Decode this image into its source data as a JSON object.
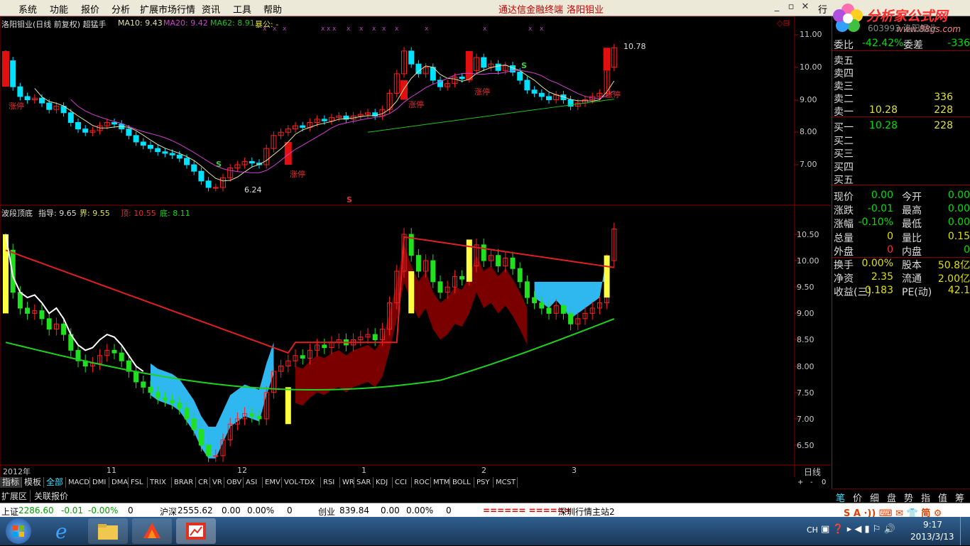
{
  "menubar": {
    "items": [
      "系统",
      "功能",
      "报价",
      "分析",
      "扩展市场行情",
      "资讯",
      "工具",
      "帮助"
    ],
    "title_left": "通达信金融终端",
    "title_right": "洛阳钼业",
    "logo_text": "分析家公式网",
    "logo_url": "www.88gs.com",
    "right_tab": "行"
  },
  "main_chart": {
    "header_title": "洛阳钼业(日线 前复权) 超猛手",
    "ma10": "MA10: 9.43",
    "ma20": "MA20: 9.42",
    "ma62": "MA62: 8.91",
    "extra": "暴公: -",
    "axis": [
      "11.00",
      "10.00",
      "9.00",
      "8.00",
      "7.00"
    ],
    "label_high": "10.78",
    "label_low": "6.24",
    "zt_labels": [
      "涨停",
      "涨停",
      "涨停",
      "涨停",
      "涨停"
    ],
    "s_labels": [
      "S",
      "S",
      "S"
    ]
  },
  "sub_chart": {
    "header_name": "波段顶底",
    "zhidao": "指导: 9.65",
    "jie": "界: 9.55",
    "ding": "顶: 10.55",
    "di": "底: 8.11",
    "axis": [
      "10.50",
      "10.00",
      "9.50",
      "9.00",
      "8.50",
      "8.00",
      "7.50",
      "7.00",
      "6.50"
    ]
  },
  "xaxis": {
    "labels": [
      "2012年",
      "11",
      "12",
      "1",
      "2",
      "3"
    ],
    "period": "日线"
  },
  "tabs": {
    "left": [
      "指标",
      "模板",
      "全部"
    ],
    "items": [
      "MACD",
      "DMI",
      "DMA",
      "FSL",
      "TRIX",
      "BRAR",
      "CR",
      "VR",
      "OBV",
      "ASI",
      "EMV",
      "VOL-TDX",
      "RSI",
      "WR",
      "SAR",
      "KDJ",
      "CCI",
      "ROC",
      "MTM",
      "BOLL",
      "PSY",
      "MCST"
    ],
    "zoom": [
      "+",
      "-",
      "0"
    ],
    "ext": [
      "扩展区",
      "关联报价"
    ]
  },
  "quote": {
    "code": "603993 洛阳钼业",
    "weibi_label": "委比",
    "weibi": "-42.42%",
    "weicha_label": "委差",
    "weicha": "-336",
    "sell": [
      {
        "label": "卖五",
        "price": "",
        "vol": ""
      },
      {
        "label": "卖四",
        "price": "",
        "vol": ""
      },
      {
        "label": "卖三",
        "price": "",
        "vol": ""
      },
      {
        "label": "卖二",
        "price": "",
        "vol": "336"
      },
      {
        "label": "卖一",
        "price": "10.28",
        "vol": "228"
      }
    ],
    "buy": [
      {
        "label": "买一",
        "price": "10.28",
        "vol": "228"
      },
      {
        "label": "买二",
        "price": "",
        "vol": ""
      },
      {
        "label": "买三",
        "price": "",
        "vol": ""
      },
      {
        "label": "买四",
        "price": "",
        "vol": ""
      },
      {
        "label": "买五",
        "price": "",
        "vol": ""
      }
    ],
    "stats": [
      {
        "l1": "现价",
        "v1": "0.00",
        "l2": "今开",
        "v2": "0.00",
        "c1": "#00e000",
        "c2": "#00e000"
      },
      {
        "l1": "涨跌",
        "v1": "-0.01",
        "l2": "最高",
        "v2": "0.00",
        "c1": "#00e000",
        "c2": "#00e000"
      },
      {
        "l1": "涨幅",
        "v1": "-0.10%",
        "l2": "最低",
        "v2": "0.00",
        "c1": "#00e000",
        "c2": "#00e000"
      },
      {
        "l1": "总量",
        "v1": "0",
        "l2": "量比",
        "v2": "0.15",
        "c1": "#e0e000",
        "c2": "#e0e000"
      },
      {
        "l1": "外盘",
        "v1": "0",
        "l2": "内盘",
        "v2": "0",
        "c1": "#ff3030",
        "c2": "#00e000"
      },
      {
        "l1": "换手",
        "v1": "0.00%",
        "l2": "股本",
        "v2": "50.8亿",
        "c1": "#e0e000",
        "c2": "#e0e000"
      },
      {
        "l1": "净资",
        "v1": "2.35",
        "l2": "流通",
        "v2": "2.00亿",
        "c1": "#e0e000",
        "c2": "#e0e000"
      },
      {
        "l1": "收益(三)",
        "v1": "0.183",
        "l2": "PE(动)",
        "v2": "42.1",
        "c1": "#e0e000",
        "c2": "#e0e000"
      }
    ],
    "bottom_tabs": [
      "笔",
      "价",
      "细",
      "盘",
      "势",
      "指",
      "值",
      "筹"
    ]
  },
  "statusbar": {
    "sh_label": "上证",
    "sh_val": "2286.60",
    "sh_chg": "-0.01",
    "sh_pct": "-0.00%",
    "sh_vol": "0",
    "hs_label": "沪深",
    "hs_val": "2555.62",
    "hs_chg": "0.00",
    "hs_pct": "0.00%",
    "hs_vol": "0",
    "cy_label": "创业",
    "cy_val": "839.84",
    "cy_chg": "0.00",
    "cy_pct": "0.00%",
    "cy_vol": "0",
    "marquee": "====== ======",
    "server": "深圳行情主站2"
  },
  "taskbar": {
    "time": "9:17",
    "date": "2013/3/13",
    "lang": "CH"
  },
  "colors": {
    "up": "#ff2020",
    "down": "#00e0ff",
    "ma10": "#e0e0a0",
    "ma20": "#d040d0",
    "ma62": "#20c020",
    "zt_red": "#e01010",
    "yellow": "#ffff40",
    "cyan_fill": "#2fb8f0",
    "dark_red_fill": "#7a0000"
  }
}
